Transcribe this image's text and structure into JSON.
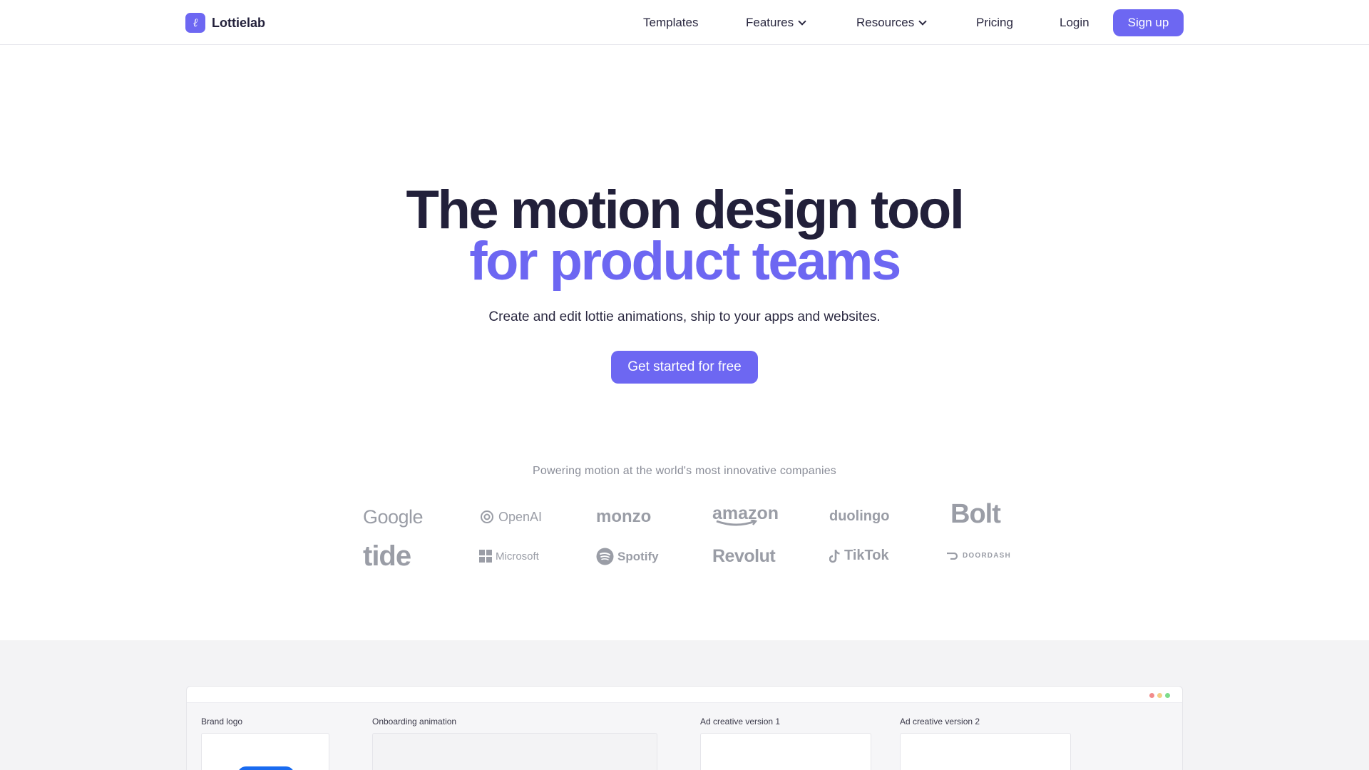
{
  "nav": {
    "brand_mark": "ℓ",
    "brand_name": "Lottielab",
    "links": {
      "templates": "Templates",
      "features": "Features",
      "resources": "Resources",
      "pricing": "Pricing",
      "login": "Login"
    },
    "signup": "Sign up"
  },
  "hero": {
    "title_line1": "The motion design tool",
    "title_line2": "for product teams",
    "subtitle": "Create and edit lottie animations, ship to your apps and websites.",
    "cta": "Get started for free"
  },
  "customers": {
    "heading": "Powering motion at the world's most innovative companies",
    "logos": [
      "Google",
      "OpenAI",
      "monzo",
      "amazon",
      "duolingo",
      "Bolt",
      "tide",
      "Microsoft",
      "Spotify",
      "Revolut",
      "TikTok",
      "DOORDASH"
    ]
  },
  "preview": {
    "frames": {
      "brand_logo": "Brand logo",
      "onboarding": "Onboarding animation",
      "ad1": "Ad creative version 1",
      "ad2": "Ad creative version 2"
    }
  },
  "colors": {
    "accent": "#6d67f2",
    "heading": "#22203a",
    "logo_gray": "#9a9da6"
  }
}
